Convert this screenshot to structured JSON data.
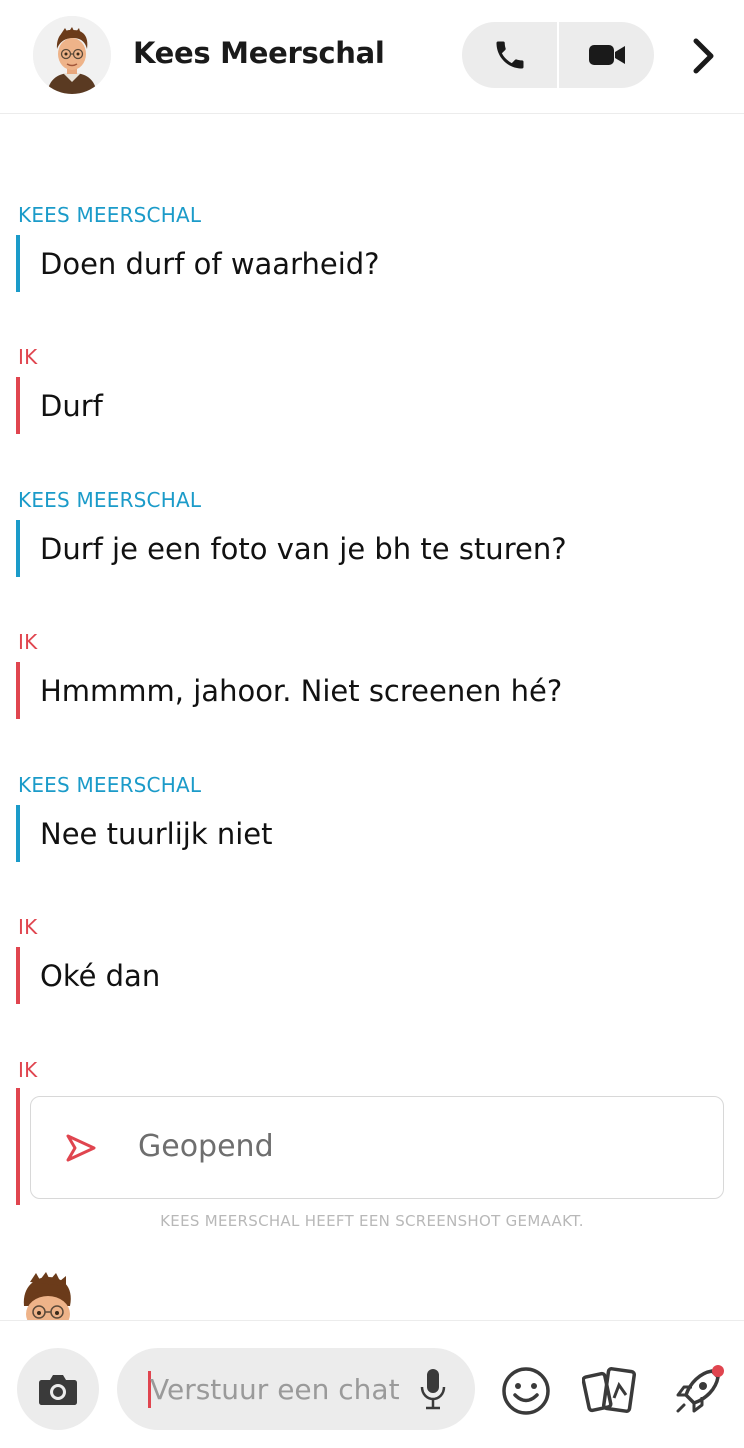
{
  "header": {
    "contact_name": "Kees Meerschal",
    "avatar_icon": "bitmoji-avatar",
    "call_icon": "phone-icon",
    "video_icon": "video-camera-icon",
    "more_icon": "chevron-right-icon"
  },
  "messages": [
    {
      "sender": "KEES MEERSCHAL",
      "text": "Doen durf of waarheid?",
      "from": "them"
    },
    {
      "sender": "IK",
      "text": "Durf",
      "from": "me"
    },
    {
      "sender": "KEES MEERSCHAL",
      "text": "Durf je een foto van je bh te sturen?",
      "from": "them"
    },
    {
      "sender": "IK",
      "text": "Hmmmm, jahoor. Niet screenen hé?",
      "from": "me"
    },
    {
      "sender": "KEES MEERSCHAL",
      "text": "Nee tuurlijk niet",
      "from": "them"
    },
    {
      "sender": "IK",
      "text": "Oké dan",
      "from": "me"
    }
  ],
  "snap": {
    "sender": "IK",
    "status": "Geopend",
    "icon": "opened-snap-arrow-icon"
  },
  "screenshot_notice": "KEES MEERSCHAL HEEFT EEN SCREENSHOT GEMAAKT.",
  "composer": {
    "placeholder": "Verstuur een chat",
    "camera_icon": "camera-icon",
    "mic_icon": "microphone-icon",
    "emoji_icon": "emoji-icon",
    "cards_icon": "cards-icon",
    "rocket_icon": "rocket-icon"
  },
  "colors": {
    "them": "#1b9bc9",
    "me": "#e0454f"
  }
}
